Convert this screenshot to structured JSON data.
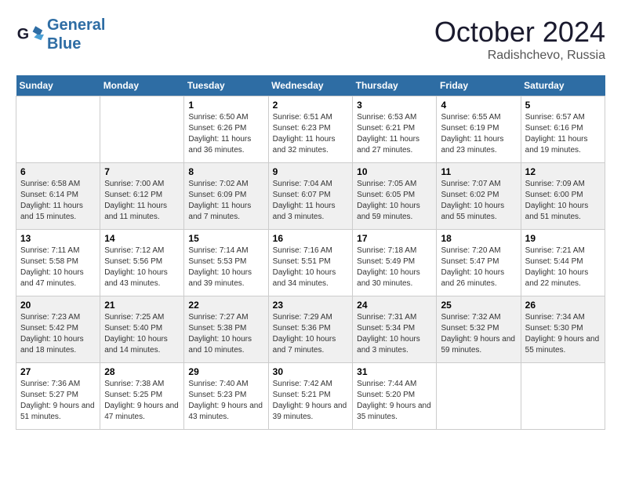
{
  "header": {
    "logo_line1": "General",
    "logo_line2": "Blue",
    "month_title": "October 2024",
    "location": "Radishchevo, Russia"
  },
  "weekdays": [
    "Sunday",
    "Monday",
    "Tuesday",
    "Wednesday",
    "Thursday",
    "Friday",
    "Saturday"
  ],
  "weeks": [
    [
      {
        "day": "",
        "info": ""
      },
      {
        "day": "",
        "info": ""
      },
      {
        "day": "1",
        "info": "Sunrise: 6:50 AM\nSunset: 6:26 PM\nDaylight: 11 hours and 36 minutes."
      },
      {
        "day": "2",
        "info": "Sunrise: 6:51 AM\nSunset: 6:23 PM\nDaylight: 11 hours and 32 minutes."
      },
      {
        "day": "3",
        "info": "Sunrise: 6:53 AM\nSunset: 6:21 PM\nDaylight: 11 hours and 27 minutes."
      },
      {
        "day": "4",
        "info": "Sunrise: 6:55 AM\nSunset: 6:19 PM\nDaylight: 11 hours and 23 minutes."
      },
      {
        "day": "5",
        "info": "Sunrise: 6:57 AM\nSunset: 6:16 PM\nDaylight: 11 hours and 19 minutes."
      }
    ],
    [
      {
        "day": "6",
        "info": "Sunrise: 6:58 AM\nSunset: 6:14 PM\nDaylight: 11 hours and 15 minutes."
      },
      {
        "day": "7",
        "info": "Sunrise: 7:00 AM\nSunset: 6:12 PM\nDaylight: 11 hours and 11 minutes."
      },
      {
        "day": "8",
        "info": "Sunrise: 7:02 AM\nSunset: 6:09 PM\nDaylight: 11 hours and 7 minutes."
      },
      {
        "day": "9",
        "info": "Sunrise: 7:04 AM\nSunset: 6:07 PM\nDaylight: 11 hours and 3 minutes."
      },
      {
        "day": "10",
        "info": "Sunrise: 7:05 AM\nSunset: 6:05 PM\nDaylight: 10 hours and 59 minutes."
      },
      {
        "day": "11",
        "info": "Sunrise: 7:07 AM\nSunset: 6:02 PM\nDaylight: 10 hours and 55 minutes."
      },
      {
        "day": "12",
        "info": "Sunrise: 7:09 AM\nSunset: 6:00 PM\nDaylight: 10 hours and 51 minutes."
      }
    ],
    [
      {
        "day": "13",
        "info": "Sunrise: 7:11 AM\nSunset: 5:58 PM\nDaylight: 10 hours and 47 minutes."
      },
      {
        "day": "14",
        "info": "Sunrise: 7:12 AM\nSunset: 5:56 PM\nDaylight: 10 hours and 43 minutes."
      },
      {
        "day": "15",
        "info": "Sunrise: 7:14 AM\nSunset: 5:53 PM\nDaylight: 10 hours and 39 minutes."
      },
      {
        "day": "16",
        "info": "Sunrise: 7:16 AM\nSunset: 5:51 PM\nDaylight: 10 hours and 34 minutes."
      },
      {
        "day": "17",
        "info": "Sunrise: 7:18 AM\nSunset: 5:49 PM\nDaylight: 10 hours and 30 minutes."
      },
      {
        "day": "18",
        "info": "Sunrise: 7:20 AM\nSunset: 5:47 PM\nDaylight: 10 hours and 26 minutes."
      },
      {
        "day": "19",
        "info": "Sunrise: 7:21 AM\nSunset: 5:44 PM\nDaylight: 10 hours and 22 minutes."
      }
    ],
    [
      {
        "day": "20",
        "info": "Sunrise: 7:23 AM\nSunset: 5:42 PM\nDaylight: 10 hours and 18 minutes."
      },
      {
        "day": "21",
        "info": "Sunrise: 7:25 AM\nSunset: 5:40 PM\nDaylight: 10 hours and 14 minutes."
      },
      {
        "day": "22",
        "info": "Sunrise: 7:27 AM\nSunset: 5:38 PM\nDaylight: 10 hours and 10 minutes."
      },
      {
        "day": "23",
        "info": "Sunrise: 7:29 AM\nSunset: 5:36 PM\nDaylight: 10 hours and 7 minutes."
      },
      {
        "day": "24",
        "info": "Sunrise: 7:31 AM\nSunset: 5:34 PM\nDaylight: 10 hours and 3 minutes."
      },
      {
        "day": "25",
        "info": "Sunrise: 7:32 AM\nSunset: 5:32 PM\nDaylight: 9 hours and 59 minutes."
      },
      {
        "day": "26",
        "info": "Sunrise: 7:34 AM\nSunset: 5:30 PM\nDaylight: 9 hours and 55 minutes."
      }
    ],
    [
      {
        "day": "27",
        "info": "Sunrise: 7:36 AM\nSunset: 5:27 PM\nDaylight: 9 hours and 51 minutes."
      },
      {
        "day": "28",
        "info": "Sunrise: 7:38 AM\nSunset: 5:25 PM\nDaylight: 9 hours and 47 minutes."
      },
      {
        "day": "29",
        "info": "Sunrise: 7:40 AM\nSunset: 5:23 PM\nDaylight: 9 hours and 43 minutes."
      },
      {
        "day": "30",
        "info": "Sunrise: 7:42 AM\nSunset: 5:21 PM\nDaylight: 9 hours and 39 minutes."
      },
      {
        "day": "31",
        "info": "Sunrise: 7:44 AM\nSunset: 5:20 PM\nDaylight: 9 hours and 35 minutes."
      },
      {
        "day": "",
        "info": ""
      },
      {
        "day": "",
        "info": ""
      }
    ]
  ]
}
